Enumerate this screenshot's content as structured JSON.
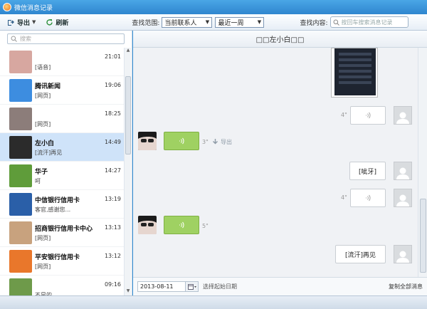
{
  "window": {
    "title": "微信消息记录"
  },
  "toolbar": {
    "export_label": "导出",
    "refresh_label": "刷新",
    "range_label": "查找范围:",
    "range_select": "当前联系人",
    "period_select": "最近一周",
    "content_label": "查找内容:",
    "search_placeholder": "按回车搜索消息记录"
  },
  "left": {
    "search_placeholder": "搜索",
    "contacts": [
      {
        "name": "",
        "time": "21:01",
        "preview": "[语音]",
        "avatar_color": "#d7a7a0"
      },
      {
        "name": "腾讯新闻",
        "time": "19:06",
        "preview": "[网页]",
        "avatar_color": "#3d8de0"
      },
      {
        "name": "",
        "time": "18:25",
        "preview": "[网页]",
        "avatar_color": "#8c7d7a"
      },
      {
        "name": "左小白",
        "time": "14:49",
        "preview": "[流汗]再见",
        "avatar_color": "#2b2b2b"
      },
      {
        "name": "华子",
        "time": "14:27",
        "preview": "呵",
        "avatar_color": "#5f9c3a"
      },
      {
        "name": "中信银行信用卡",
        "time": "13:19",
        "preview": "客官,感谢您...",
        "avatar_color": "#2a5fa8"
      },
      {
        "name": "招商银行信用卡中心",
        "time": "13:13",
        "preview": "[网页]",
        "avatar_color": "#c8a27e"
      },
      {
        "name": "平安银行信用卡",
        "time": "13:12",
        "preview": "[网页]",
        "avatar_color": "#e9772b"
      },
      {
        "name": "",
        "time": "09:16",
        "preview": "不是的",
        "avatar_color": "#6e9a4a"
      }
    ]
  },
  "chat": {
    "header_title": "□□左小白□□",
    "messages": [
      {
        "side": "right",
        "type": "voice",
        "duration": "4\""
      },
      {
        "side": "left",
        "type": "voice",
        "duration": "3\"",
        "action": "导出"
      },
      {
        "side": "right",
        "type": "text",
        "text": "[呲牙]"
      },
      {
        "side": "right",
        "type": "voice",
        "duration": "4\""
      },
      {
        "side": "left",
        "type": "voice",
        "duration": "5\""
      },
      {
        "side": "right",
        "type": "text",
        "text": "[流汗]再见"
      }
    ],
    "footer": {
      "date_value": "2013-08-11",
      "date_hint": "选择起始日期",
      "copy_all": "复制全部消息"
    }
  },
  "colors": {
    "accent": "#3a93d8",
    "selected": "#cfe3f9",
    "bubble_left": "#9fd162"
  }
}
